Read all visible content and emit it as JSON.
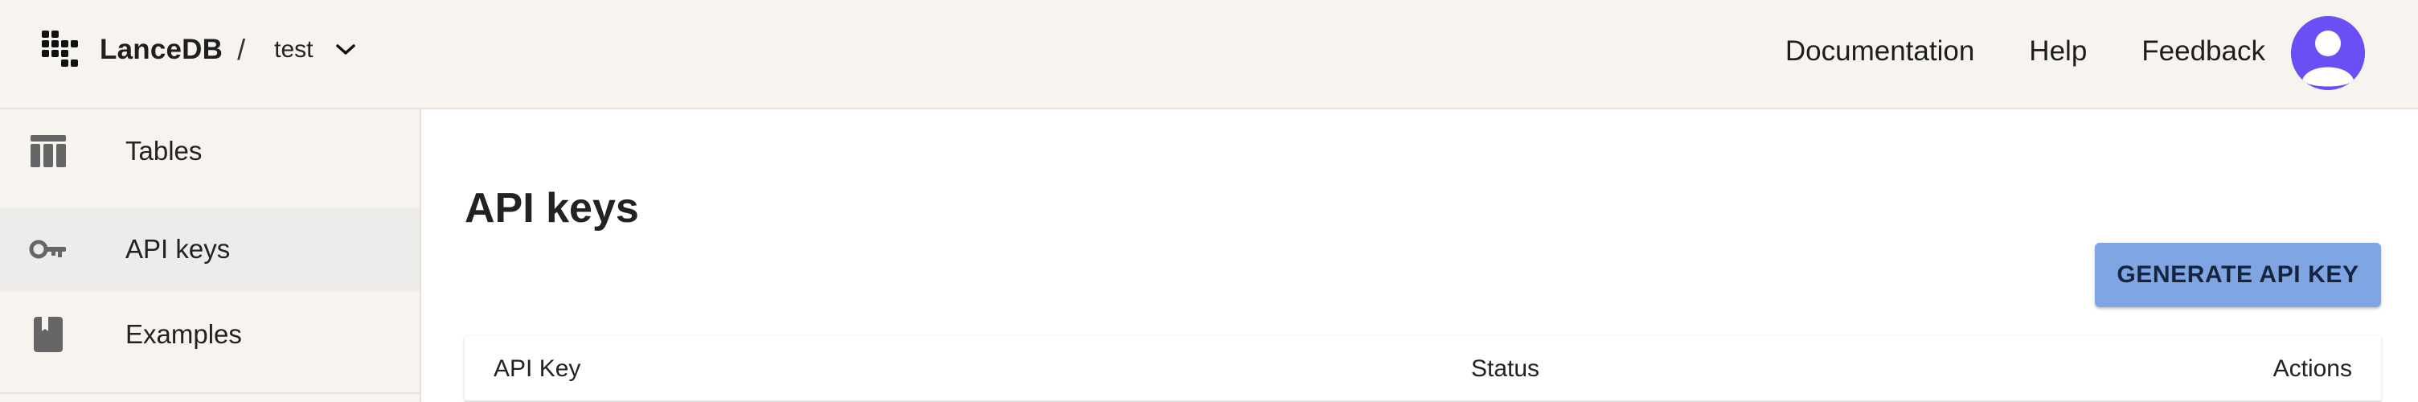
{
  "header": {
    "brand_name": "LanceDB",
    "separator": "/",
    "project": "test",
    "links": [
      "Documentation",
      "Help",
      "Feedback"
    ]
  },
  "sidebar": {
    "items": [
      {
        "label": "Tables",
        "icon": "table-icon",
        "active": false
      },
      {
        "label": "API keys",
        "icon": "key-icon",
        "active": true
      },
      {
        "label": "Examples",
        "icon": "book-icon",
        "active": false
      }
    ]
  },
  "main": {
    "title": "API keys",
    "generate_button_label": "GENERATE API KEY",
    "table": {
      "columns": [
        "API Key",
        "Status",
        "Actions"
      ]
    }
  },
  "colors": {
    "header_bg": "#f7f4ef",
    "sidebar_active_bg": "#eeecea",
    "main_bg": "#ffffff",
    "button_bg": "#7fa6e3",
    "avatar_bg": "#6a4ff5"
  }
}
